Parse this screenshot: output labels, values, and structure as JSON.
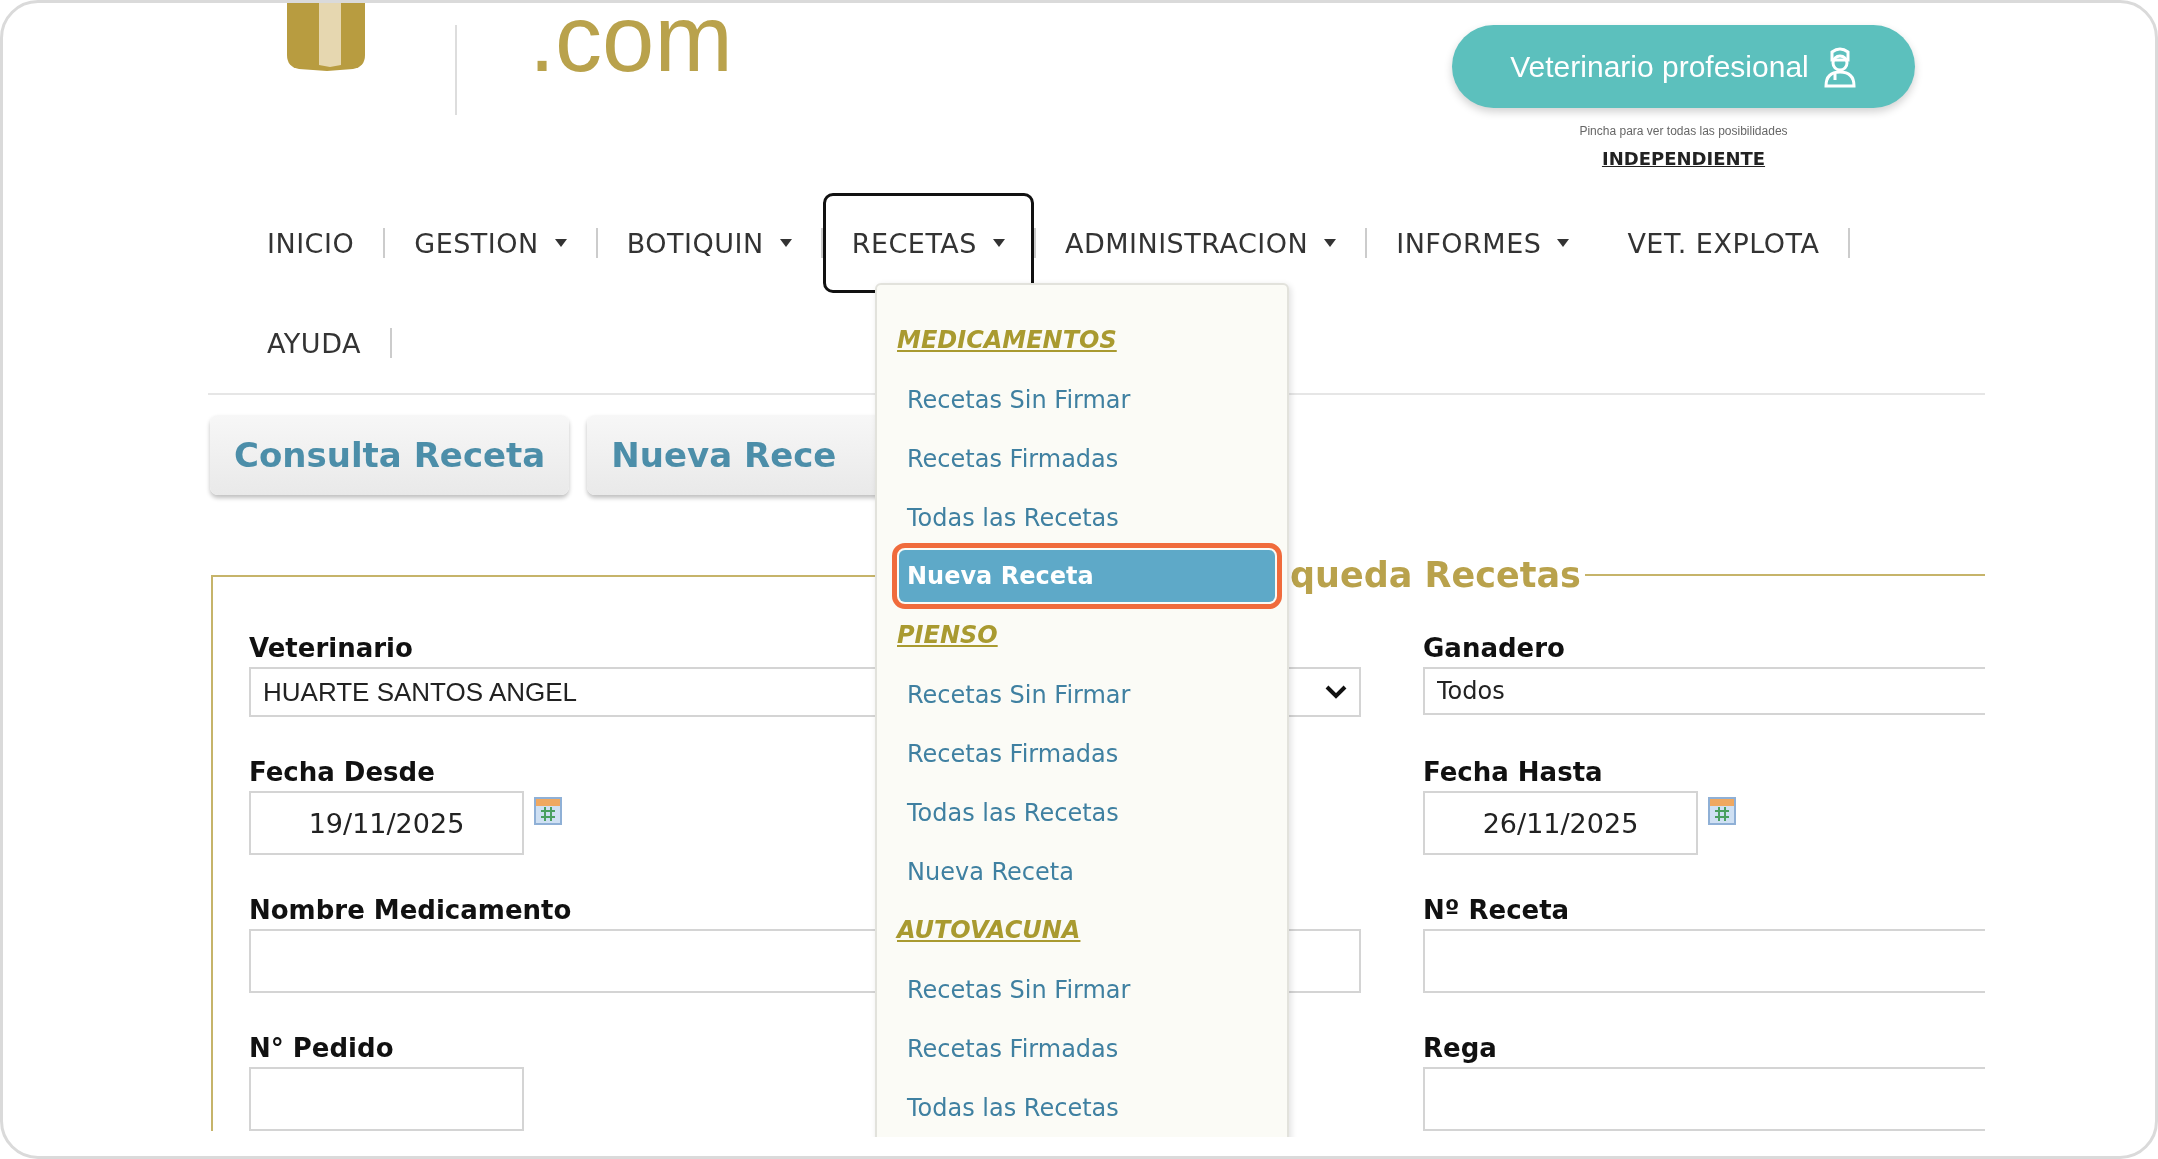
{
  "header": {
    "domain": ".com",
    "pro_button": "Veterinario profesional",
    "hint": "Pincha para ver todas las posibilidades",
    "license_link": "INDEPENDIENTE"
  },
  "nav": [
    {
      "label": "INICIO",
      "dropdown": false,
      "selected": false
    },
    {
      "label": "GESTION",
      "dropdown": true,
      "selected": false
    },
    {
      "label": "BOTIQUIN",
      "dropdown": true,
      "selected": false
    },
    {
      "label": "RECETAS",
      "dropdown": true,
      "selected": true
    },
    {
      "label": "ADMINISTRACION",
      "dropdown": true,
      "selected": false
    },
    {
      "label": "INFORMES",
      "dropdown": true,
      "selected": false
    },
    {
      "label": "VET. EXPLOTA",
      "dropdown": false,
      "selected": false
    },
    {
      "label": "AYUDA",
      "dropdown": false,
      "selected": false
    }
  ],
  "tabs": [
    {
      "label": "Consulta Receta"
    },
    {
      "label": "Nueva Rece"
    }
  ],
  "search_panel": {
    "legend": "queda Recetas",
    "fields": [
      {
        "label": "Veterinario",
        "kind": "select",
        "value": "HUARTE SANTOS ANGEL"
      },
      {
        "label": "Ganadero",
        "kind": "text",
        "value": "Todos"
      },
      {
        "label": "Fecha Desde",
        "kind": "date",
        "value": "19/11/2025"
      },
      {
        "label": "Fecha Hasta",
        "kind": "date",
        "value": "26/11/2025"
      },
      {
        "label": "Nombre Medicamento",
        "kind": "text"
      },
      {
        "label": "Nº Receta",
        "kind": "text"
      },
      {
        "label": "N° Pedido",
        "kind": "short"
      },
      {
        "label": "Rega",
        "kind": "text"
      }
    ]
  },
  "recetas_menu": {
    "groups": [
      {
        "header": "MEDICAMENTOS",
        "items": [
          {
            "label": "Recetas Sin Firmar",
            "selected": false
          },
          {
            "label": "Recetas Firmadas",
            "selected": false
          },
          {
            "label": "Todas las Recetas",
            "selected": false
          },
          {
            "label": "Nueva Receta",
            "selected": true
          }
        ]
      },
      {
        "header": "PIENSO",
        "items": [
          {
            "label": "Recetas Sin Firmar",
            "selected": false
          },
          {
            "label": "Recetas Firmadas",
            "selected": false
          },
          {
            "label": "Todas las Recetas",
            "selected": false
          },
          {
            "label": "Nueva Receta",
            "selected": false
          }
        ]
      },
      {
        "header": "AUTOVACUNA",
        "items": [
          {
            "label": "Recetas Sin Firmar",
            "selected": false
          },
          {
            "label": "Recetas Firmadas",
            "selected": false
          },
          {
            "label": "Todas las Recetas",
            "selected": false
          }
        ]
      }
    ]
  }
}
